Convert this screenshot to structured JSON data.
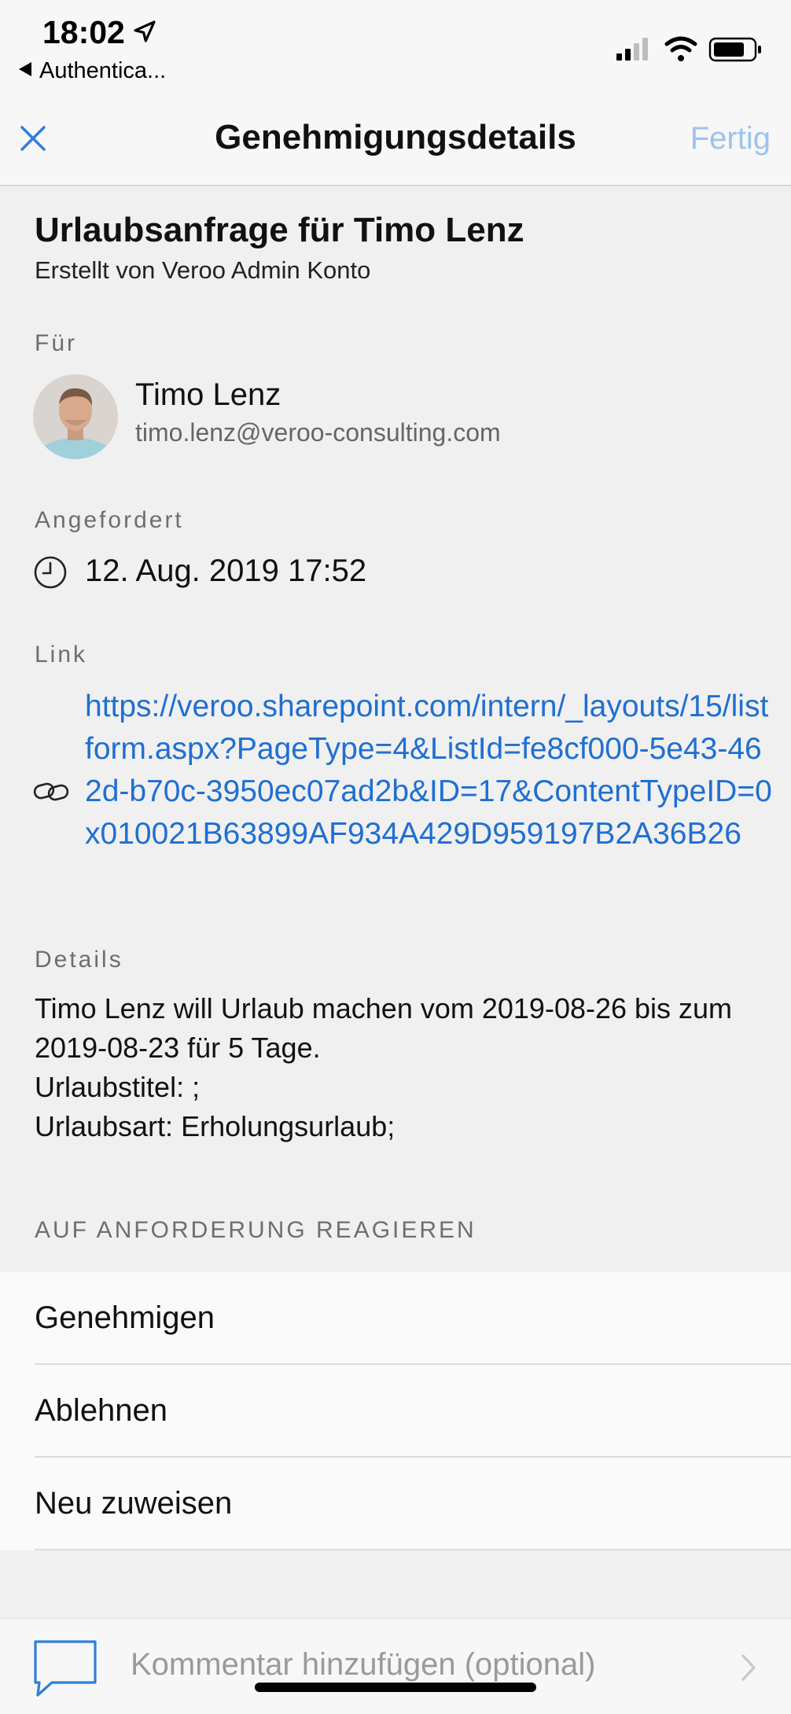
{
  "status_bar": {
    "time": "18:02",
    "back_app": "Authentica..."
  },
  "nav": {
    "title": "Genehmigungsdetails",
    "done_label": "Fertig"
  },
  "request": {
    "title": "Urlaubsanfrage für Timo Lenz",
    "created_by": "Erstellt von Veroo Admin Konto"
  },
  "for_section": {
    "label": "Für",
    "name": "Timo Lenz",
    "email": "timo.lenz@veroo-consulting.com"
  },
  "requested_section": {
    "label": "Angefordert",
    "date": "12. Aug. 2019 17:52"
  },
  "link_section": {
    "label": "Link",
    "url": "https://veroo.sharepoint.com/intern/_layouts/15/listform.aspx?PageType=4&ListId=fe8cf000-5e43-462d-b70c-3950ec07ad2b&ID=17&ContentTypeID=0x010021B63899AF934A429D959197B2A36B26"
  },
  "details_section": {
    "label": "Details",
    "lines": [
      "Timo Lenz will Urlaub machen vom 2019-08-26 bis zum 2019-08-23 für 5 Tage.",
      "Urlaubstitel: ;",
      "Urlaubsart: Erholungsurlaub;"
    ]
  },
  "actions": {
    "label": "AUF ANFORDERUNG REAGIEREN",
    "items": [
      "Genehmigen",
      "Ablehnen",
      "Neu zuweisen"
    ]
  },
  "comment": {
    "placeholder": "Kommentar hinzufügen (optional)"
  },
  "colors": {
    "link": "#1f6fd1",
    "done_disabled": "#9cc4ec",
    "accent": "#2f7fd6"
  },
  "icons": [
    "location-arrow-icon",
    "back-arrow-icon",
    "signal-icon",
    "wifi-icon",
    "battery-icon",
    "close-icon",
    "clock-icon",
    "link-icon",
    "comment-icon",
    "chevron-right-icon"
  ]
}
